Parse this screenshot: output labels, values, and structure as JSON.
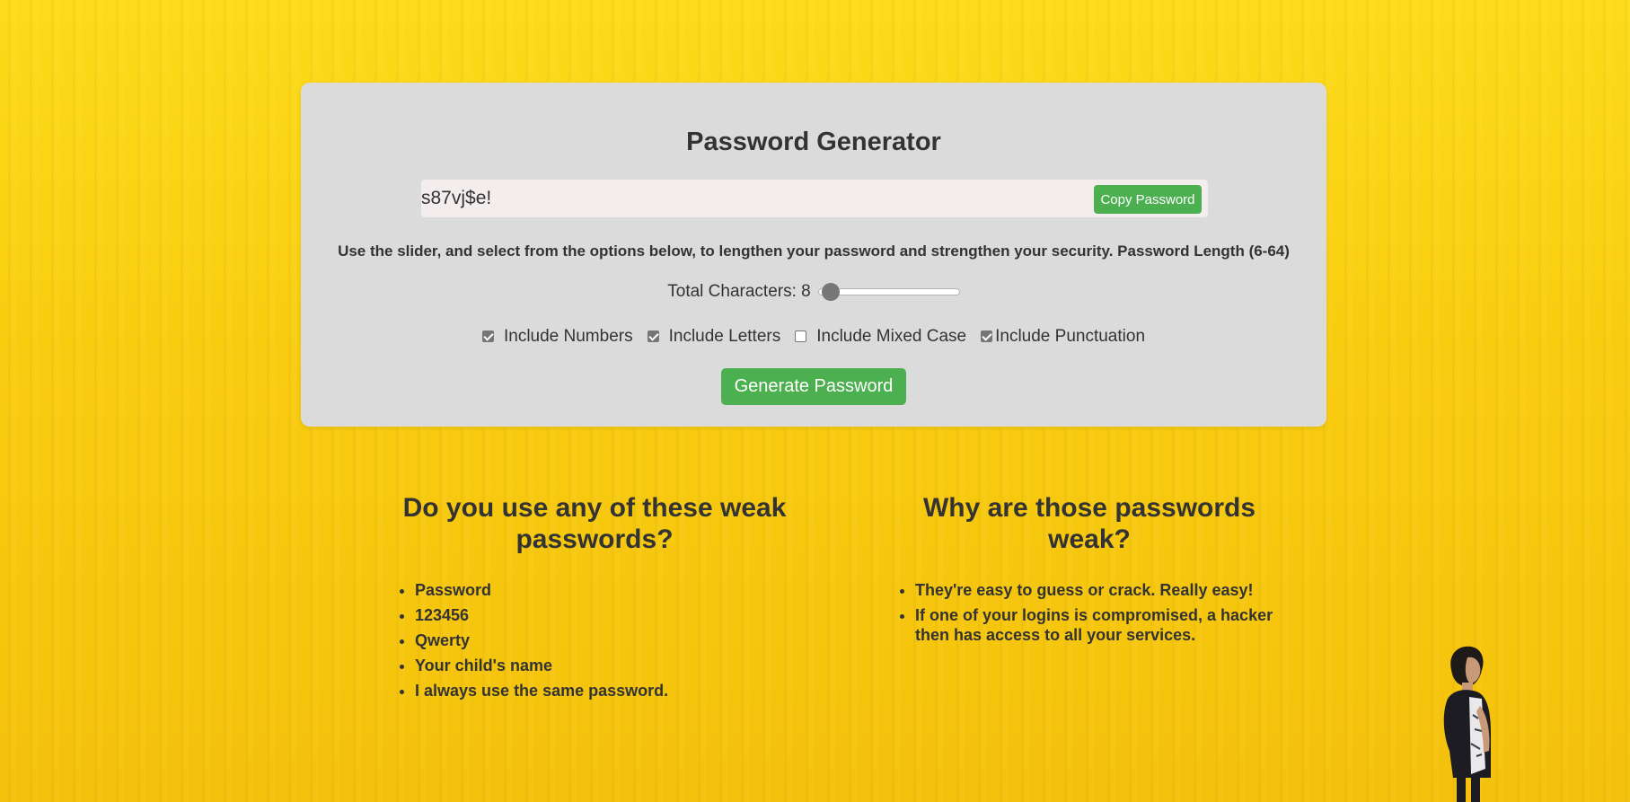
{
  "generator": {
    "title": "Password Generator",
    "password_value": "s87vj$e!",
    "copy_label": "Copy Password",
    "instructions": "Use the slider, and select from the options below, to lengthen your password and strengthen your security. Password Length (6-64)",
    "length_label": "Total Characters: 8",
    "length": {
      "value": 8,
      "min": 6,
      "max": 64
    },
    "options": [
      {
        "label": "Include Numbers",
        "checked": true
      },
      {
        "label": "Include Letters",
        "checked": true
      },
      {
        "label": "Include Mixed Case",
        "checked": false
      },
      {
        "label": "Include Punctuation",
        "checked": true
      }
    ],
    "generate_label": "Generate Password"
  },
  "weak": {
    "heading": "Do you use any of these weak passwords?",
    "items": [
      "Password",
      "123456",
      "Qwerty",
      "Your child's name",
      "I always use the same password."
    ]
  },
  "why": {
    "heading": "Why are those passwords weak?",
    "items": [
      "They're easy to guess or crack. Really easy!",
      "If one of your logins is compromised, a hacker then has access to all your services."
    ]
  },
  "colors": {
    "background": "#f8cc10",
    "card": "#dcdbdb",
    "accent_button": "#4caf50",
    "text": "#333333"
  }
}
